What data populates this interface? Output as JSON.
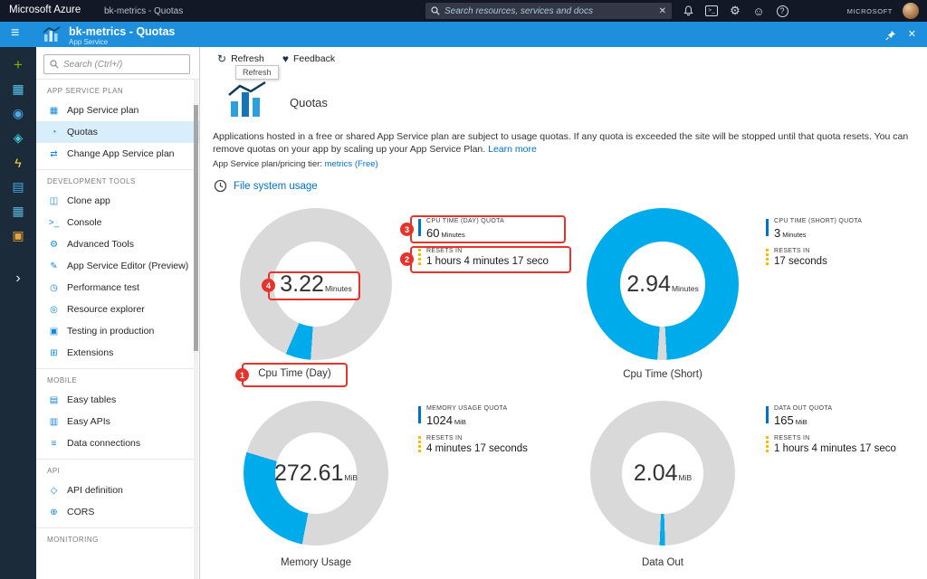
{
  "topbar": {
    "brand": "Microsoft Azure",
    "breadcrumb": "bk-metrics - Quotas",
    "search_placeholder": "Search resources, services and docs",
    "directory": "MICROSOFT"
  },
  "header": {
    "title": "bk-metrics - Quotas",
    "subtitle": "App Service"
  },
  "rail": {
    "items": [
      {
        "name": "new",
        "glyph": "+"
      },
      {
        "name": "dashboard",
        "glyph": "▦"
      },
      {
        "name": "all-resources",
        "glyph": "◉"
      },
      {
        "name": "resource-groups",
        "glyph": "◈"
      },
      {
        "name": "functions",
        "glyph": "ϟ"
      },
      {
        "name": "sql-databases",
        "glyph": "▤"
      },
      {
        "name": "app-services",
        "glyph": "▦"
      },
      {
        "name": "storage",
        "glyph": "▣"
      },
      {
        "name": "more-services",
        "glyph": "›"
      }
    ]
  },
  "sidebar": {
    "search_placeholder": "Search (Ctrl+/)",
    "sections": [
      {
        "label": "APP SERVICE PLAN",
        "items": [
          {
            "label": "App Service plan",
            "icon": "▦"
          },
          {
            "label": "Quotas",
            "icon": "◔",
            "selected": true
          },
          {
            "label": "Change App Service plan",
            "icon": "⇄"
          }
        ]
      },
      {
        "label": "DEVELOPMENT TOOLS",
        "items": [
          {
            "label": "Clone app",
            "icon": "◫"
          },
          {
            "label": "Console",
            "icon": ">_"
          },
          {
            "label": "Advanced Tools",
            "icon": "⚙"
          },
          {
            "label": "App Service Editor (Preview)",
            "icon": "✎"
          },
          {
            "label": "Performance test",
            "icon": "◷"
          },
          {
            "label": "Resource explorer",
            "icon": "◎"
          },
          {
            "label": "Testing in production",
            "icon": "▣"
          },
          {
            "label": "Extensions",
            "icon": "⊞"
          }
        ]
      },
      {
        "label": "MOBILE",
        "items": [
          {
            "label": "Easy tables",
            "icon": "▤"
          },
          {
            "label": "Easy APIs",
            "icon": "▥"
          },
          {
            "label": "Data connections",
            "icon": "≡"
          }
        ]
      },
      {
        "label": "API",
        "items": [
          {
            "label": "API definition",
            "icon": "◇"
          },
          {
            "label": "CORS",
            "icon": "⊕"
          }
        ]
      },
      {
        "label": "MONITORING",
        "items": []
      }
    ]
  },
  "toolbar": {
    "refresh_label": "Refresh",
    "feedback_label": "Feedback",
    "tooltip": "Refresh"
  },
  "content": {
    "page_title": "Quotas",
    "description": "Applications hosted in a free or shared App Service plan are subject to usage quotas. If any quota is exceeded the site will be stopped until that quota resets. You can remove quotas on your app by scaling up your App Service Plan.",
    "learn_more": "Learn more",
    "pricing_label": "App Service plan/pricing tier:",
    "pricing_link": "metrics (Free)",
    "file_system_usage": "File system usage"
  },
  "chart_data": [
    {
      "type": "donut",
      "title": "Cpu Time (Day)",
      "used": 3.22,
      "quota": 60,
      "unit": "Minutes",
      "start_deg": 184
    },
    {
      "type": "donut",
      "title": "Cpu Time (Short)",
      "used": 2.94,
      "quota": 3,
      "unit": "Minutes",
      "start_deg": 184
    },
    {
      "type": "donut",
      "title": "Memory Usage",
      "used": 272.61,
      "quota": 1024,
      "unit": "MiB",
      "start_deg": 191
    },
    {
      "type": "donut",
      "title": "Data Out",
      "used": 2.04,
      "quota": 165,
      "unit": "MiB",
      "start_deg": 178
    }
  ],
  "quota_info": [
    {
      "quota_label": "CPU TIME (DAY) QUOTA",
      "resets_label": "RESETS IN",
      "resets_value": "1 hours 4 minutes 17 seco"
    },
    {
      "quota_label": "CPU TIME (SHORT) QUOTA",
      "resets_label": "RESETS IN",
      "resets_value": "17 seconds"
    },
    {
      "quota_label": "MEMORY USAGE QUOTA",
      "resets_label": "RESETS IN",
      "resets_value": "4 minutes 17 seconds"
    },
    {
      "quota_label": "DATA OUT QUOTA",
      "resets_label": "RESETS IN",
      "resets_value": "1 hours 4 minutes 17 seco"
    }
  ],
  "annotations": [
    "1",
    "2",
    "3",
    "4"
  ],
  "icons": {
    "refresh": "↻",
    "feedback": "♥",
    "close": "✕",
    "clear": "✕",
    "hamburger": "≡",
    "gear": "⚙",
    "smiley": "☺",
    "help": "?",
    "shell": "&gt;_"
  },
  "colors": {
    "accent_blue": "#1d8fdd",
    "link_blue": "#0072c6",
    "donut_used": "#00abec",
    "donut_free": "#d9d9d9",
    "quota_bar": "#0072c6",
    "resets_bar": "#fdb900",
    "annotation_red": "#e5342b",
    "selected_item_bg": "#d8eefa"
  }
}
